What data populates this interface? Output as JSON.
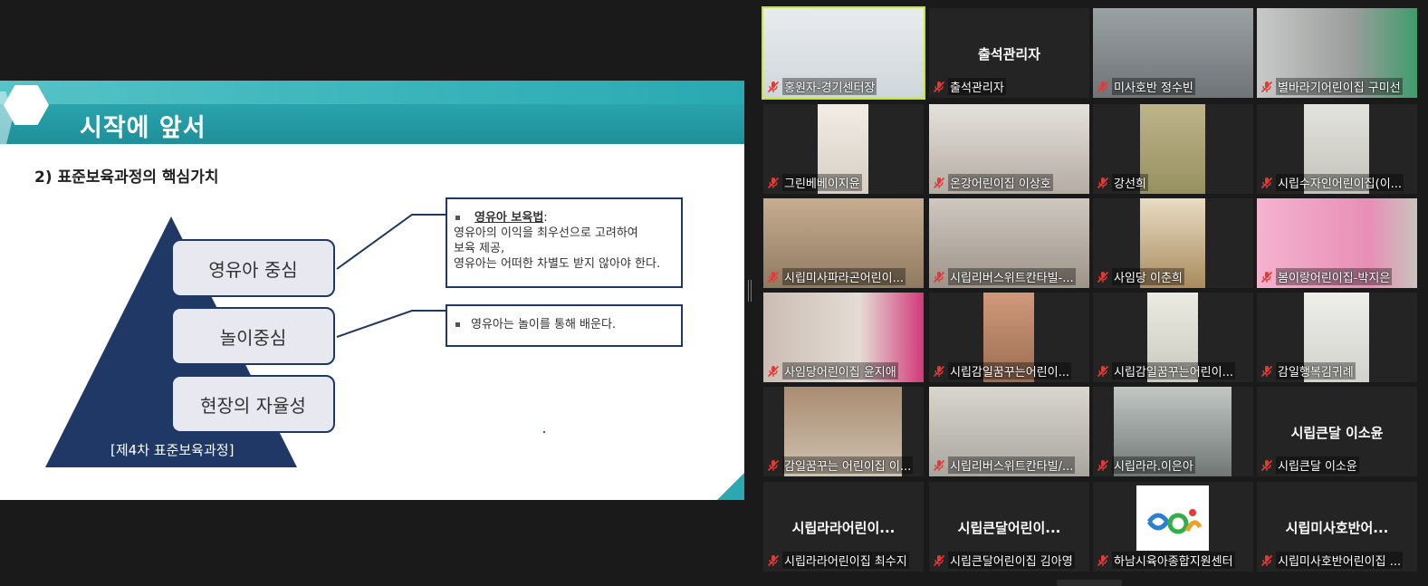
{
  "slide": {
    "title": "시작에 앞서",
    "subtitle": "2) 표준보육과정의 핵심가치",
    "tiers": [
      "영유아 중심",
      "놀이중심",
      "현장의 자율성"
    ],
    "pyramid_caption": "[제4차 표준보육과정]",
    "callout1": {
      "heading": "영유아 보육법",
      "heading_suffix": " :",
      "lines": [
        "영유아의 이익을 최우선으로 고려하여",
        "보육 제공,",
        "영유아는 어떠한 차별도 받지 않아야 한다."
      ]
    },
    "callout2": {
      "text": "영유아는 놀이를 통해 배운다."
    },
    "colors": {
      "teal": "#2fb0b8",
      "navy": "#1f3866"
    }
  },
  "participants": [
    {
      "name": "홍원자-경기센터장",
      "center_label": "",
      "kind": "video",
      "active": true
    },
    {
      "name": "출석관리자",
      "center_label": "출석관리자",
      "kind": "name"
    },
    {
      "name": "미사호반 정수빈",
      "center_label": "",
      "kind": "video"
    },
    {
      "name": "별바라기어린이집 구미선",
      "center_label": "",
      "kind": "video"
    },
    {
      "name": "그린베베이지윤",
      "center_label": "",
      "kind": "video"
    },
    {
      "name": "온강어린이집 이상호",
      "center_label": "",
      "kind": "video"
    },
    {
      "name": "강선희",
      "center_label": "",
      "kind": "video"
    },
    {
      "name": "시립수자인어린이집(이...",
      "center_label": "",
      "kind": "video"
    },
    {
      "name": "시립미사파라곤어린이...",
      "center_label": "",
      "kind": "video"
    },
    {
      "name": "시립리버스위트칸타빌-...",
      "center_label": "",
      "kind": "video"
    },
    {
      "name": "사임당 이춘희",
      "center_label": "",
      "kind": "video"
    },
    {
      "name": "봄이랑어린이집-박지은",
      "center_label": "",
      "kind": "video"
    },
    {
      "name": "사임당어린이집 윤지애",
      "center_label": "",
      "kind": "video"
    },
    {
      "name": "시립감일꿈꾸는어린이...",
      "center_label": "",
      "kind": "video"
    },
    {
      "name": "시립감일꿈꾸는어린이...",
      "center_label": "",
      "kind": "video"
    },
    {
      "name": "감일행복김귀례",
      "center_label": "",
      "kind": "video"
    },
    {
      "name": "감일꿈꾸는 어린이집 이...",
      "center_label": "",
      "kind": "video"
    },
    {
      "name": "시립리버스위트칸타빌/...",
      "center_label": "",
      "kind": "video"
    },
    {
      "name": "시립라라.이은아",
      "center_label": "",
      "kind": "video"
    },
    {
      "name": "시립큰달 이소윤",
      "center_label": "시립큰달 이소윤",
      "kind": "name"
    },
    {
      "name": "시립라라어린이집 최수지",
      "center_label": "시립라라어린이...",
      "kind": "name"
    },
    {
      "name": "시립큰달어린이집 김아영",
      "center_label": "시립큰달어린이...",
      "kind": "name"
    },
    {
      "name": "하남시육아종합지원센터",
      "center_label": "",
      "kind": "logo"
    },
    {
      "name": "시립미사호반어린이집 ...",
      "center_label": "시립미사호반어...",
      "kind": "name"
    }
  ]
}
